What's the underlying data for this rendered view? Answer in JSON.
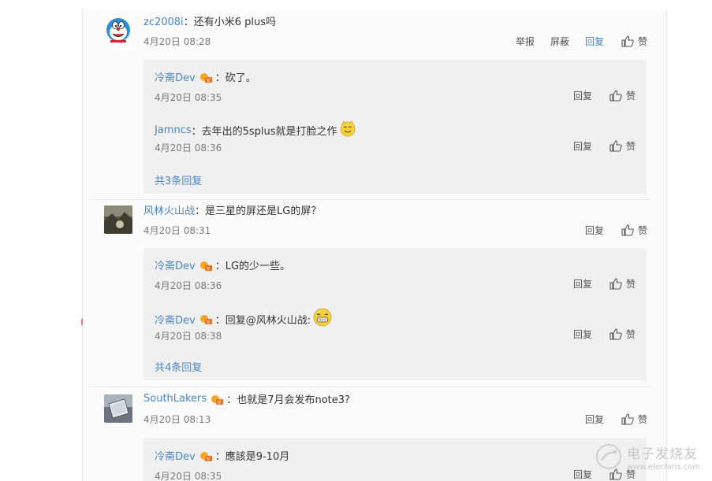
{
  "comments": [
    {
      "username": "zc2008i",
      "separator": "：",
      "text": "还有小米6 plus吗",
      "time": "4月20日 08:28",
      "actions": [
        "举报",
        "屏蔽",
        "回复"
      ],
      "like_label": "赞",
      "replies": [
        {
          "username": "冷斋Dev",
          "separator": "：",
          "text": "砍了。",
          "time": "4月20日 08:35",
          "reply_label": "回复",
          "like_label": "赞"
        },
        {
          "username": "Jamncs",
          "separator": "：",
          "text": "去年出的5splus就是打脸之作",
          "time": "4月20日 08:36",
          "reply_label": "回复",
          "like_label": "赞"
        }
      ],
      "more": "共3条回复"
    },
    {
      "username": "风林火山战",
      "separator": "：",
      "text": "是三星的屏还是LG的屏？",
      "time": "4月20日 08:31",
      "reply_label": "回复",
      "like_label": "赞",
      "replies": [
        {
          "username": "冷斋Dev",
          "separator": "：",
          "text": "LG的少一些。",
          "time": "4月20日 08:36",
          "reply_label": "回复",
          "like_label": "赞"
        },
        {
          "username": "冷斋Dev",
          "separator": "：",
          "text": "回复@风林火山战:",
          "time": "4月20日 08:38",
          "reply_label": "回复",
          "like_label": "赞"
        }
      ],
      "more": "共4条回复"
    },
    {
      "username": "SouthLakers",
      "separator": "：",
      "text": "也就是7月会发布note3?",
      "time": "4月20日 08:13",
      "reply_label": "回复",
      "like_label": "赞",
      "replies": [
        {
          "username": "冷斋Dev",
          "separator": "：",
          "text": "應該是9-10月",
          "time": "4月20日 08:35",
          "reply_label": "回复",
          "like_label": "赞"
        }
      ]
    }
  ],
  "watermark": {
    "name": "电子发烧友",
    "url": "www.elecfans.com"
  },
  "colors": {
    "link": "#4a86c5",
    "reply_bg": "#f0f0f0",
    "meta": "#7a7a7a"
  },
  "icons": [
    "doraemon-avatar",
    "landscape-avatar",
    "phone-avatar",
    "thumb-up-icon",
    "v-badge-icon",
    "smiley-emoji",
    "grin-emoji"
  ]
}
